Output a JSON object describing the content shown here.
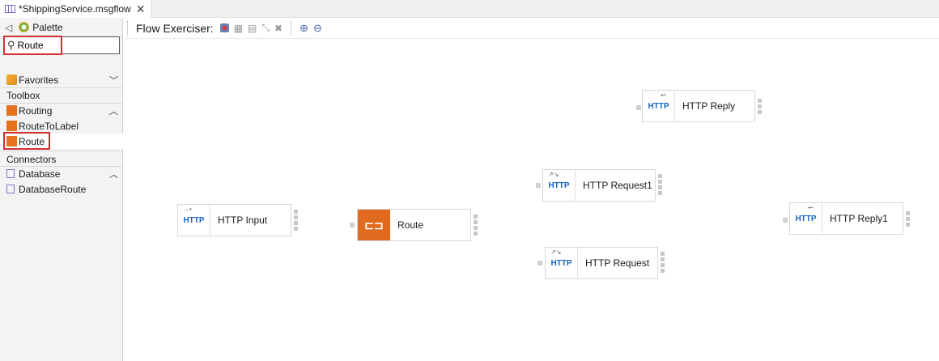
{
  "editor": {
    "tab_title": "*ShippingService.msgflow",
    "close_glyph": "✕"
  },
  "palette": {
    "title": "Palette",
    "search_value": "Route",
    "favorites_label": "Favorites",
    "toolbox_label": "Toolbox",
    "routing_label": "Routing",
    "route_to_label": "RouteToLabel",
    "route_label": "Route",
    "connectors_label": "Connectors",
    "database_label": "Database",
    "database_route_label": "DatabaseRoute",
    "chev_down": "﹀",
    "chev_up": "︿"
  },
  "flowbar": {
    "label": "Flow Exerciser:"
  },
  "nodes": {
    "http_input": {
      "icon": "HTTP",
      "label": "HTTP Input"
    },
    "route": {
      "icon": "⊏⊐",
      "label": "Route"
    },
    "http_request1": {
      "icon": "HTTP",
      "label": "HTTP Request1"
    },
    "http_request": {
      "icon": "HTTP",
      "label": "HTTP Request"
    },
    "http_reply": {
      "icon": "HTTP",
      "label": "HTTP Reply"
    },
    "http_reply1": {
      "icon": "HTTP",
      "label": "HTTP Reply1"
    }
  },
  "colors": {
    "highlight": "#d32f2f",
    "route_node": "#e06b1f",
    "http_text": "#1565c0"
  }
}
